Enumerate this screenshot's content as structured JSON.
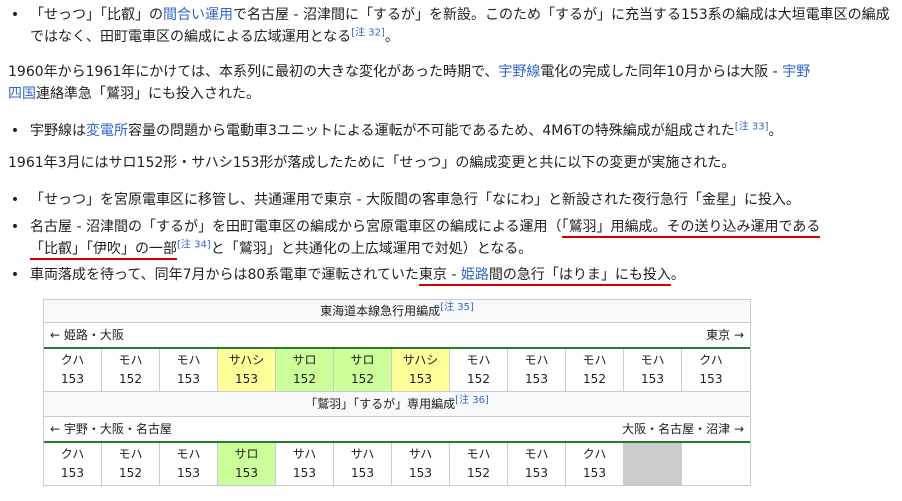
{
  "bullet1": {
    "pre": "「せっつ」「比叡」の",
    "link1": "間合い運用",
    "mid": "で名古屋 - 沼津間に「するが」を新設。このため「するが」に充当する153系の編成は大垣電車区の編成ではなく、田町電車区の編成による広域運用となる",
    "note": "[注 32]",
    "post": "。"
  },
  "para1": {
    "pre": "1960年から1961年にかけては、本系列に最初の大きな変化があった時期で、",
    "link1": "宇野線",
    "mid": "電化の完成した同年10月からは大阪 - ",
    "link2": "宇野",
    "mid2": "間の",
    "link3": "四国",
    "post": "連絡準急「鷲羽」にも投入された。"
  },
  "bullet2": {
    "pre": "宇野線は",
    "link1": "変電所",
    "mid": "容量の問題から電動車3ユニットによる運転が不可能であるため、4M6Tの特殊編成が組成された",
    "note": "[注 33]",
    "post": "。"
  },
  "para2": {
    "text": "1961年3月にはサロ152形・サハシ153形が落成したために「せっつ」の編成変更と共に以下の変更が実施された。"
  },
  "bullet3": {
    "text": "「せっつ」を宮原電車区に移管し、共通運用で東京 - 大阪間の客車急行「なにわ」と新設された夜行急行「金星」に投入。"
  },
  "bullet4": {
    "pre": "名古屋 - 沼津間の「するが」を田町電車区の編成から宮原電車区の編成による運用（",
    "ul1": "「鷲羽」用編成。その送り込み運用である",
    "ul2": "「比叡」「伊吹」の一部",
    "note": "[注 34]",
    "post": "と「鷲羽」と共通化の上広域運用で対処）となる。"
  },
  "bullet5": {
    "pre": "車両落成を待って、同年7月からは80系電車で運転されていた",
    "ul_pre": "東京 - ",
    "ul_link": "姫路",
    "ul_post": "間の急行「はりま」にも投入",
    "post": "。"
  },
  "table1": {
    "title": "東海道本線急行用編成",
    "note": "[注 35]",
    "dir_left": "← 姫路・大阪",
    "dir_right": "東京 →",
    "cars": [
      {
        "type": "クハ",
        "num": "153",
        "color": "white"
      },
      {
        "type": "モハ",
        "num": "152",
        "color": "white"
      },
      {
        "type": "モハ",
        "num": "153",
        "color": "white"
      },
      {
        "type": "サハシ",
        "num": "153",
        "color": "yellow"
      },
      {
        "type": "サロ",
        "num": "152",
        "color": "green"
      },
      {
        "type": "サロ",
        "num": "152",
        "color": "green"
      },
      {
        "type": "サハシ",
        "num": "153",
        "color": "yellow"
      },
      {
        "type": "モハ",
        "num": "152",
        "color": "white"
      },
      {
        "type": "モハ",
        "num": "153",
        "color": "white"
      },
      {
        "type": "モハ",
        "num": "152",
        "color": "white"
      },
      {
        "type": "モハ",
        "num": "153",
        "color": "white"
      },
      {
        "type": "クハ",
        "num": "153",
        "color": "white"
      }
    ]
  },
  "table2": {
    "title": "「鷲羽」「するが」専用編成",
    "note": "[注 36]",
    "dir_left": "← 宇野・大阪・名古屋",
    "dir_right": "大阪・名古屋・沼津 →",
    "cars": [
      {
        "type": "クハ",
        "num": "153",
        "color": "white"
      },
      {
        "type": "モハ",
        "num": "152",
        "color": "white"
      },
      {
        "type": "モハ",
        "num": "153",
        "color": "white"
      },
      {
        "type": "サロ",
        "num": "153",
        "color": "green"
      },
      {
        "type": "サハ",
        "num": "153",
        "color": "white"
      },
      {
        "type": "サハ",
        "num": "153",
        "color": "white"
      },
      {
        "type": "サハ",
        "num": "153",
        "color": "white"
      },
      {
        "type": "モハ",
        "num": "152",
        "color": "white"
      },
      {
        "type": "モハ",
        "num": "153",
        "color": "white"
      },
      {
        "type": "クハ",
        "num": "153",
        "color": "white"
      },
      {
        "type": "",
        "num": "",
        "color": "gray"
      }
    ]
  }
}
